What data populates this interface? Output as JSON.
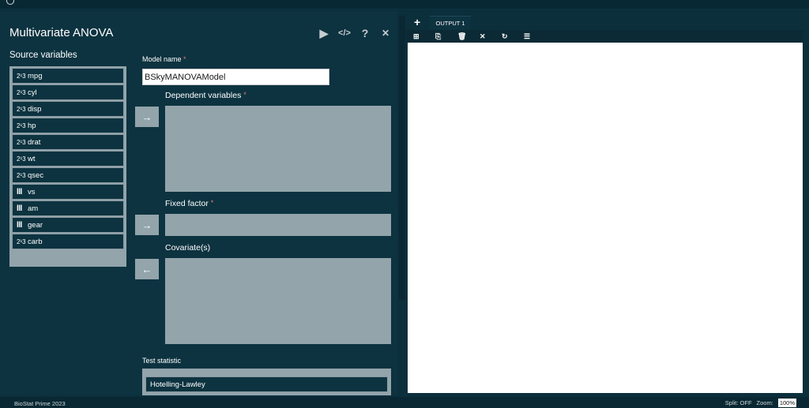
{
  "dialog": {
    "title": "Multivariate ANOVA",
    "tools": [
      {
        "icon": "run-icon",
        "glyph": "▶"
      },
      {
        "icon": "code-icon",
        "glyph": "</>"
      },
      {
        "icon": "help-icon",
        "glyph": "?"
      },
      {
        "icon": "close-icon",
        "glyph": "✕"
      }
    ],
    "source_label": "Source variables",
    "variables": [
      {
        "type": "scale",
        "icon_text": "2¹3",
        "name": "mpg"
      },
      {
        "type": "scale",
        "icon_text": "2¹3",
        "name": "cyl"
      },
      {
        "type": "scale",
        "icon_text": "2¹3",
        "name": "disp"
      },
      {
        "type": "scale",
        "icon_text": "2¹3",
        "name": "hp"
      },
      {
        "type": "scale",
        "icon_text": "2¹3",
        "name": "drat"
      },
      {
        "type": "scale",
        "icon_text": "2¹3",
        "name": "wt"
      },
      {
        "type": "scale",
        "icon_text": "2¹3",
        "name": "qsec"
      },
      {
        "type": "nominal",
        "icon_text": "lll",
        "name": "vs"
      },
      {
        "type": "nominal",
        "icon_text": "lll",
        "name": "am"
      },
      {
        "type": "nominal",
        "icon_text": "lll",
        "name": "gear"
      },
      {
        "type": "scale",
        "icon_text": "2¹3",
        "name": "carb"
      }
    ],
    "model_name_label": "Model name",
    "model_name_value": "BSkyMANOVAModel",
    "required_mark": "*",
    "dependent_label": "Dependent variables",
    "fixed_factor_label": "Fixed factor",
    "covariates_label": "Covariate(s)",
    "arrow_right": "→",
    "arrow_left": "←",
    "test_statistic_label": "Test statistic",
    "test_statistic_option": "Hotelling-Lawley"
  },
  "output": {
    "add_tab": "+",
    "tab_label": "OUTPUT 1",
    "toolbar": [
      {
        "icon": "add-box-icon",
        "glyph": "⊞"
      },
      {
        "icon": "export-icon",
        "glyph": "⎘"
      },
      {
        "icon": "trash-icon",
        "glyph": "🗑"
      },
      {
        "icon": "close-icon",
        "glyph": "✕"
      },
      {
        "icon": "refresh-icon",
        "glyph": "↻"
      },
      {
        "icon": "list-icon",
        "glyph": "☰"
      }
    ]
  },
  "status": {
    "app_name": "BioStat Prime 2023",
    "split": "Split: OFF",
    "zoom_label": "Zoom:",
    "zoom_value": "100%"
  }
}
